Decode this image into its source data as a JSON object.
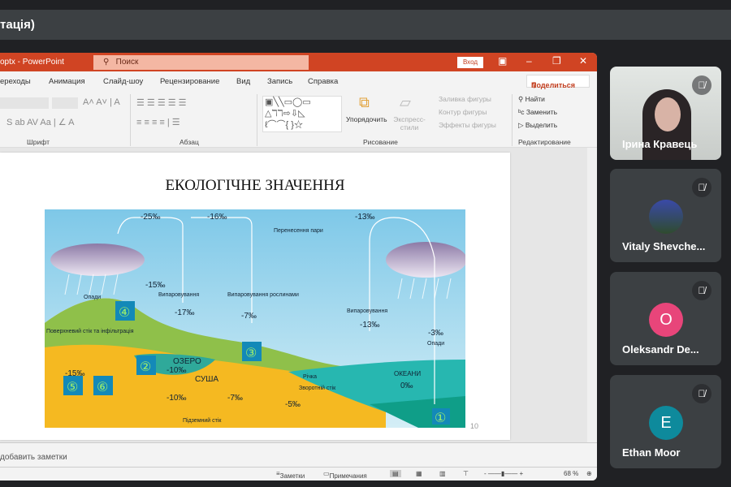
{
  "meet": {
    "title_fragment": "тація)"
  },
  "ppt": {
    "window_title": "optx - PowerPoint",
    "search_placeholder": "Поиск",
    "login_label": "Вход",
    "share_label": "Поделиться",
    "tabs": [
      "ереходы",
      "Анимация",
      "Слайд-шоу",
      "Рецензирование",
      "Вид",
      "Запись",
      "Справка"
    ],
    "groups": [
      "Шрифт",
      "Абзац",
      "Рисование",
      "Редактирование"
    ],
    "ribbon": {
      "arrange": "Упорядочить",
      "quick_styles": "Экспресс-стили",
      "fill": "Заливка фигуры",
      "outline": "Контур фигуры",
      "effects": "Эффекты фигуры",
      "find": "Найти",
      "replace": "Заменить",
      "select": "Выделить"
    },
    "slide": {
      "title": "ЕКОЛОГІЧНЕ ЗНАЧЕННЯ",
      "page_number": "10",
      "diagram_labels": {
        "top_left": "-25‰",
        "top_mid": "-16‰",
        "top_right": "-13‰",
        "vapor_transfer": "Перенесення пари",
        "precip_left": "Опади",
        "precip_right": "Опади",
        "evap_left": "Випаровування",
        "evap_left_val": "-15‰",
        "evap_plants": "Випаровування рослинами",
        "evap_plants_val": "-7‰",
        "lake_evap_val": "-17‰",
        "surface_runoff": "Поверхневий стік та інфільтрація",
        "lake": "ОЗЕРО",
        "lake_val": "-10‰",
        "land": "СУША",
        "soil_val": "-15‰",
        "ground_left_val": "-10‰",
        "ground_mid_val": "-7‰",
        "groundwater": "Підземний стік",
        "river": "Річка",
        "return_flow": "Зворотній стік",
        "return_val": "-5‰",
        "evap_ocean": "Випаровування",
        "evap_ocean_val": "-13‰",
        "precip_ocean_val": "-3‰",
        "ocean": "ОКЕАНИ",
        "ocean_val": "0‰",
        "markers": [
          "①",
          "②",
          "③",
          "④",
          "⑤",
          "⑥"
        ]
      }
    },
    "notes_placeholder": "добавить заметки",
    "status": {
      "notes": "Заметки",
      "comments": "Примечания",
      "zoom": "68 %"
    }
  },
  "participants": [
    {
      "name": "Ірина Кравець",
      "muted": true,
      "video": true
    },
    {
      "name": "Vitaly Shevche...",
      "muted": true,
      "video": false
    },
    {
      "name": "Oleksandr De...",
      "muted": true,
      "initial": "O",
      "color": "#e8457a"
    },
    {
      "name": "Ethan Moor",
      "muted": true,
      "initial": "E",
      "color": "#0e8a9c"
    }
  ]
}
